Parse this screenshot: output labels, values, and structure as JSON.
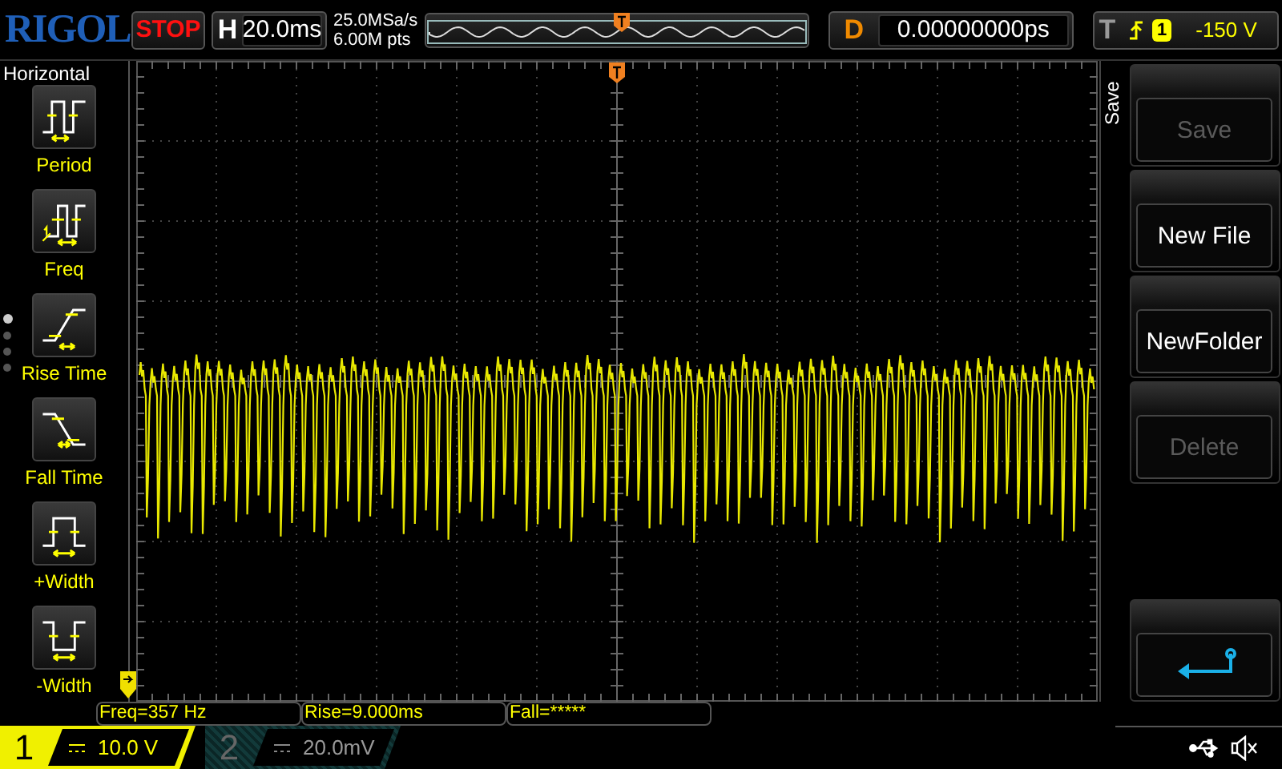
{
  "header": {
    "brand": "RIGOL",
    "run_state": "STOP",
    "timebase_label": "H",
    "timebase": "20.0ms",
    "sample_rate": "25.0MSa/s",
    "memory_depth": "6.00M pts",
    "delay_label": "D",
    "delay": "0.00000000ps",
    "trigger_label": "T",
    "trigger_source": "1",
    "trigger_level": "-150 V"
  },
  "measure_menu": {
    "title": "Horizontal",
    "items": [
      {
        "label": "Period",
        "kind": "period"
      },
      {
        "label": "Freq",
        "kind": "freq"
      },
      {
        "label": "Rise Time",
        "kind": "rise"
      },
      {
        "label": "Fall Time",
        "kind": "fall"
      },
      {
        "label": "+Width",
        "kind": "pwidth"
      },
      {
        "label": "-Width",
        "kind": "nwidth"
      }
    ],
    "pages": [
      {
        "selected": true
      },
      {
        "selected": false
      },
      {
        "selected": false
      },
      {
        "selected": false
      }
    ]
  },
  "save_menu": {
    "title": "Save",
    "buttons": [
      {
        "kind": "text",
        "label": "Save",
        "disabled": true
      },
      {
        "kind": "text",
        "label": "New File",
        "disabled": false
      },
      {
        "kind": "text",
        "label": "NewFolder",
        "disabled": false
      },
      {
        "kind": "text",
        "label": "Delete",
        "disabled": true
      },
      {
        "kind": "back",
        "disabled": false
      }
    ]
  },
  "measurements": [
    "Freq=357 Hz",
    "Rise=9.000ms",
    "Fall=*****"
  ],
  "channels": [
    {
      "number": "1",
      "scale": "10.0 V",
      "enabled": true
    },
    {
      "number": "2",
      "scale": "20.0mV",
      "enabled": false
    }
  ]
}
